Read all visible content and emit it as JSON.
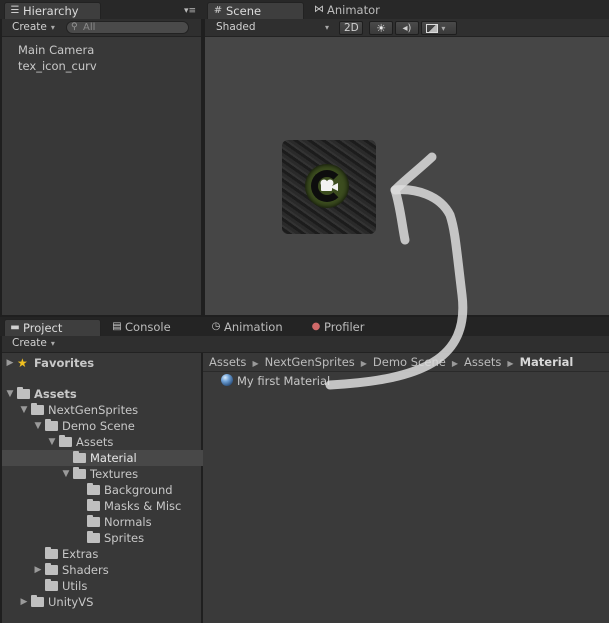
{
  "hierarchy": {
    "tab_label": "Hierarchy",
    "create_label": "Create",
    "search_placeholder": "All",
    "items": [
      "Main Camera",
      "tex_icon_curv"
    ]
  },
  "scene": {
    "tabs": [
      "Scene",
      "Animator"
    ],
    "shading_mode": "Shaded",
    "mode_2d_label": "2D"
  },
  "bottom_tabs": [
    "Project",
    "Console",
    "Animation",
    "Profiler"
  ],
  "project": {
    "create_label": "Create",
    "favorites_label": "Favorites",
    "tree": [
      {
        "label": "Assets",
        "bold": true
      },
      {
        "label": "NextGenSprites"
      },
      {
        "label": "Demo Scene"
      },
      {
        "label": "Assets"
      },
      {
        "label": "Material",
        "selected": true
      },
      {
        "label": "Textures"
      },
      {
        "label": "Background"
      },
      {
        "label": "Masks & Misc"
      },
      {
        "label": "Normals"
      },
      {
        "label": "Sprites"
      },
      {
        "label": "Extras"
      },
      {
        "label": "Shaders"
      },
      {
        "label": "Utils"
      },
      {
        "label": "UnityVS"
      }
    ],
    "breadcrumb": [
      "Assets",
      "NextGenSprites",
      "Demo Scene",
      "Assets",
      "Material"
    ],
    "files": [
      "My first Material"
    ]
  }
}
